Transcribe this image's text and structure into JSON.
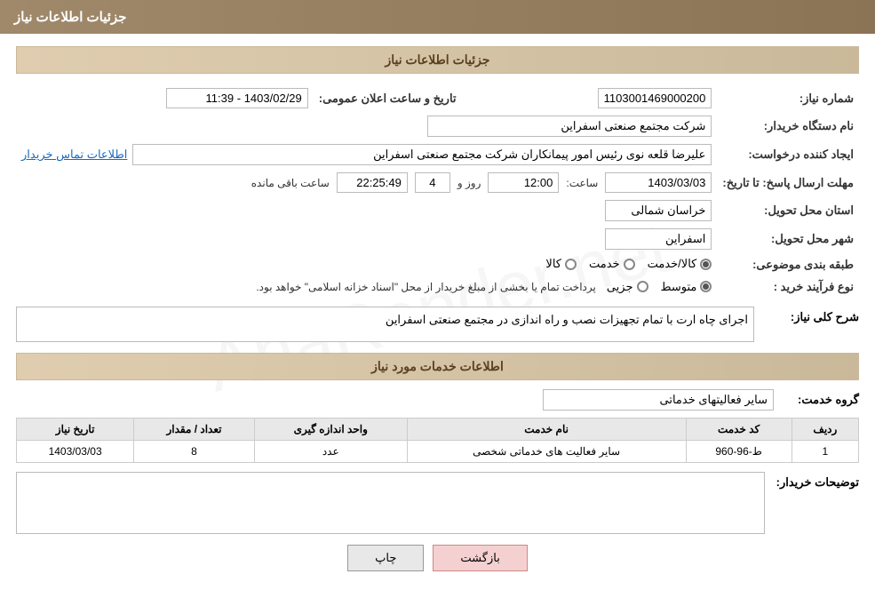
{
  "header": {
    "title": "جزئیات اطلاعات نیاز"
  },
  "section1": {
    "title": "جزئیات اطلاعات نیاز"
  },
  "fields": {
    "shomara_niaz_label": "شماره نیاز:",
    "shomara_niaz_value": "1103001469000200",
    "nam_dastgah_label": "نام دستگاه خریدار:",
    "nam_dastgah_value": "شرکت مجتمع صنعتی اسفراین",
    "creator_label": "ایجاد کننده درخواست:",
    "creator_value": "علیرضا قلعه نوی رئیس امور پیمانکاران شرکت مجتمع صنعتی اسفراین",
    "creator_link": "اطلاعات تماس خریدار",
    "deadline_label": "مهلت ارسال پاسخ: تا تاریخ:",
    "date_value": "1403/03/03",
    "time_label": "ساعت:",
    "time_value": "12:00",
    "day_label": "روز و",
    "days_value": "4",
    "remaining_label": "ساعت باقی مانده",
    "remaining_value": "22:25:49",
    "announcement_label": "تاریخ و ساعت اعلان عمومی:",
    "announcement_value": "1403/02/29 - 11:39",
    "province_label": "استان محل تحویل:",
    "province_value": "خراسان شمالی",
    "city_label": "شهر محل تحویل:",
    "city_value": "اسفراین",
    "category_label": "طبقه بندی موضوعی:",
    "category_options": [
      {
        "label": "کالا",
        "selected": false
      },
      {
        "label": "خدمت",
        "selected": false
      },
      {
        "label": "کالا/خدمت",
        "selected": true
      }
    ],
    "purchase_type_label": "نوع فرآیند خرید :",
    "purchase_options": [
      {
        "label": "جزیی",
        "selected": false
      },
      {
        "label": "متوسط",
        "selected": true
      }
    ],
    "purchase_note": "پرداخت تمام یا بخشی از مبلغ خریدار از محل \"اسناد خزانه اسلامی\" خواهد بود.",
    "general_desc_label": "شرح کلی نیاز:",
    "general_desc_value": "اجرای چاه ارت با تمام تجهیزات نصب و راه اندازی در مجتمع صنعتی اسفراین"
  },
  "services_section": {
    "title": "اطلاعات خدمات مورد نیاز",
    "service_group_label": "گروه خدمت:",
    "service_group_value": "سایر فعالیتهای خدماتی",
    "table_headers": [
      "ردیف",
      "کد خدمت",
      "نام خدمت",
      "واحد اندازه گیری",
      "تعداد / مقدار",
      "تاریخ نیاز"
    ],
    "table_rows": [
      {
        "row_num": "1",
        "code": "ط-96-960",
        "name": "سایر فعالیت های خدماتی شخصی",
        "unit": "عدد",
        "quantity": "8",
        "date": "1403/03/03"
      }
    ]
  },
  "buyer_desc": {
    "label": "توضیحات خریدار:",
    "value": ""
  },
  "buttons": {
    "print_label": "چاپ",
    "back_label": "بازگشت"
  }
}
